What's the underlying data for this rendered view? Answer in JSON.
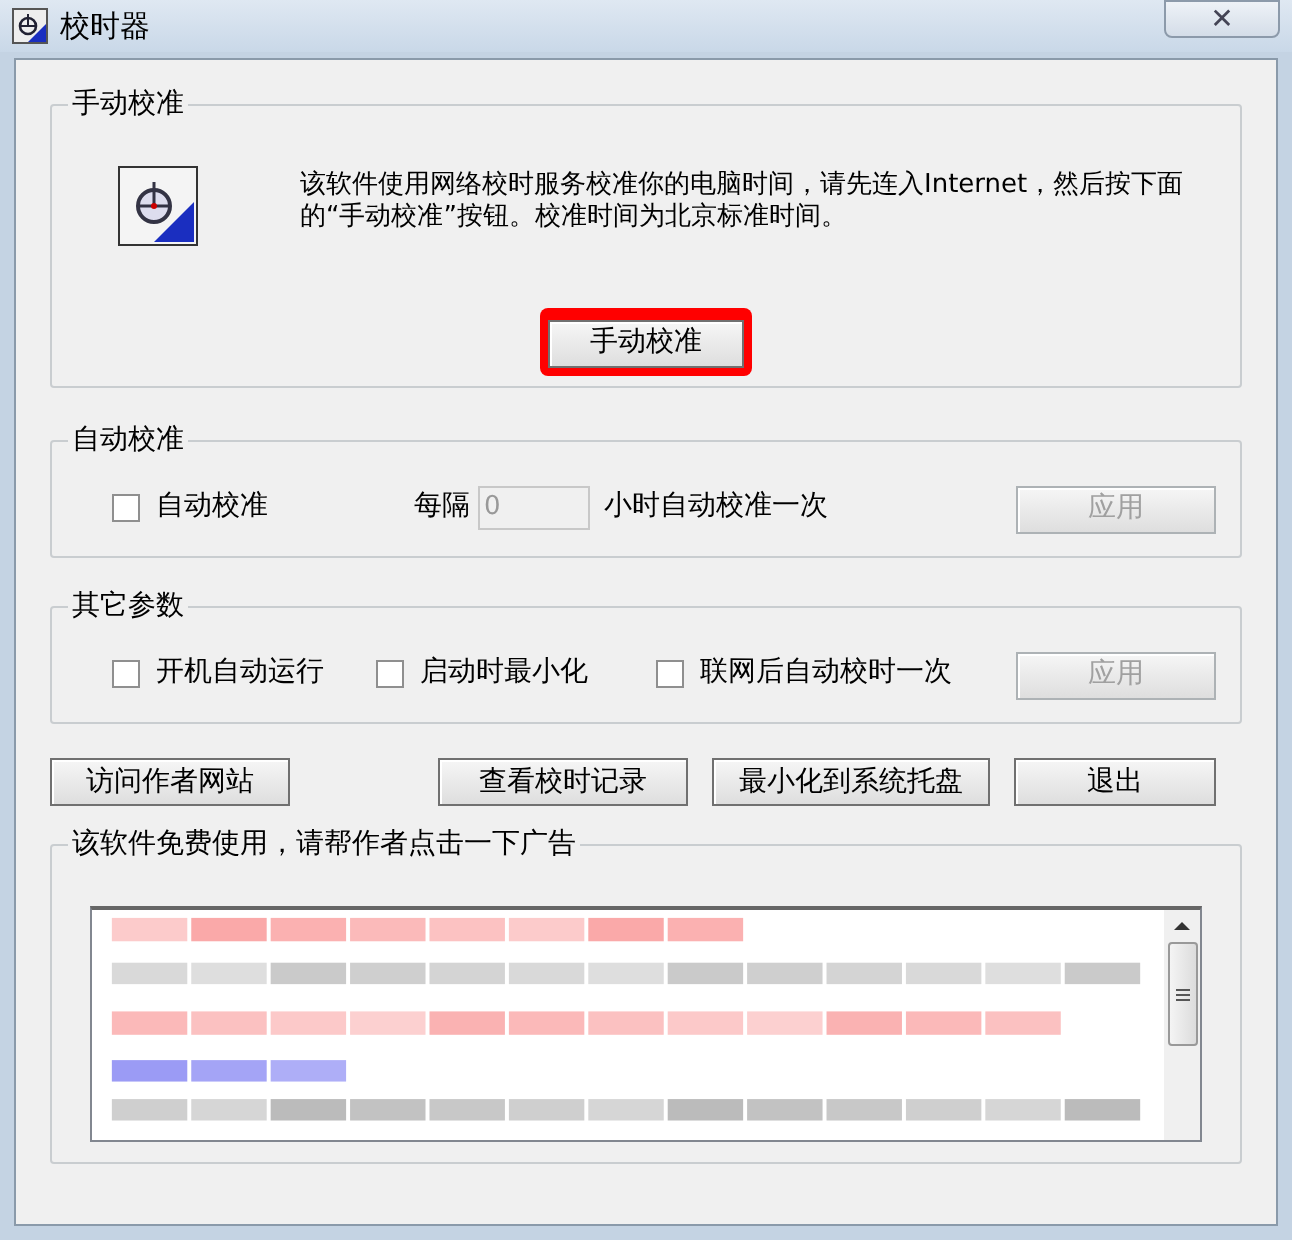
{
  "window": {
    "title": "校时器",
    "close": "✕"
  },
  "manual": {
    "title": "手动校准",
    "description": "该软件使用网络校时服务校准你的电脑时间，请先连入Internet，然后按下面的“手动校准”按钮。校准时间为北京标准时间。",
    "button": {
      "label": "手动校准",
      "highlighted": true
    }
  },
  "auto": {
    "title": "自动校准",
    "checkbox": {
      "label": "自动校准",
      "checked": false
    },
    "interval_prefix": "每隔",
    "interval": {
      "value": "0",
      "disabled": true
    },
    "interval_suffix": "小时自动校准一次",
    "apply": {
      "label": "应用",
      "disabled": true
    }
  },
  "other": {
    "title": "其它参数",
    "options": [
      {
        "label": "开机自动运行",
        "checked": false
      },
      {
        "label": "启动时最小化",
        "checked": false
      },
      {
        "label": "联网后自动校时一次",
        "checked": false
      }
    ],
    "apply": {
      "label": "应用",
      "disabled": true
    }
  },
  "buttons": [
    {
      "label": "访问作者网站"
    },
    {
      "label": "查看校时记录"
    },
    {
      "label": "最小化到系统托盘"
    },
    {
      "label": "退出"
    }
  ],
  "ad": {
    "title": "该软件免费使用，请帮作者点击一下广告"
  }
}
